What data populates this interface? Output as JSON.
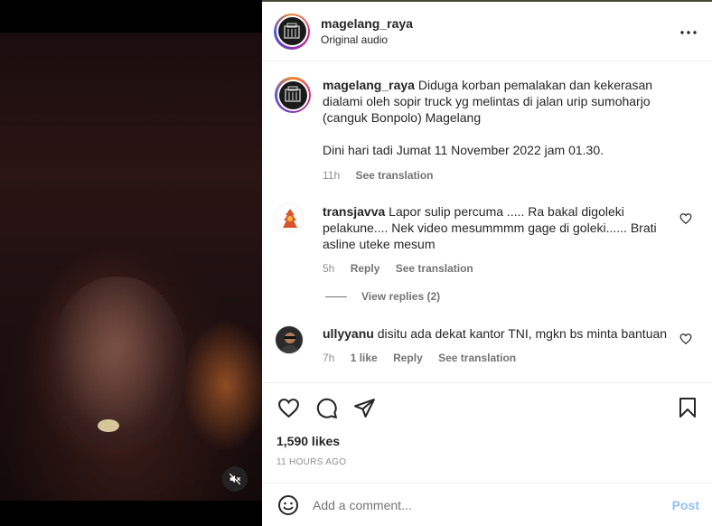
{
  "post": {
    "username": "magelang_raya",
    "audio": "Original audio",
    "caption_user": "magelang_raya",
    "caption_text": "Diduga korban pemalakan dan kekerasan dialami oleh sopir truck yg melintas di jalan urip sumoharjo (canguk Bonpolo) Magelang",
    "caption_text2": "Dini hari tadi Jumat 11 November 2022 jam 01.30.",
    "caption_time": "11h",
    "see_translation": "See translation"
  },
  "comments": [
    {
      "username": "transjavva",
      "text": "Lapor sulip percuma ..... Ra bakal digoleki pelakune.... Nek video mesummmm gage di goleki...... Brati asline uteke mesum",
      "time": "5h",
      "reply": "Reply",
      "see_translation": "See translation",
      "view_replies": "View replies (2)"
    },
    {
      "username": "ullyyanu",
      "text": "disitu ada dekat kantor TNI, mgkn bs minta bantuan",
      "time": "7h",
      "likes": "1 like",
      "reply": "Reply",
      "see_translation": "See translation"
    }
  ],
  "likes": "1,590 likes",
  "time_ago": "11 HOURS AGO",
  "add_comment": {
    "placeholder": "Add a comment...",
    "post_label": "Post"
  },
  "icons": {
    "more": "more-horizontal-icon",
    "heart": "heart-icon",
    "comment": "comment-icon",
    "share": "paper-plane-icon",
    "save": "bookmark-icon",
    "emoji": "smiley-icon",
    "mute": "muted-speaker-icon"
  },
  "colors": {
    "accent_post": "#8fc2f5",
    "muted_text": "#8e8e8e"
  }
}
